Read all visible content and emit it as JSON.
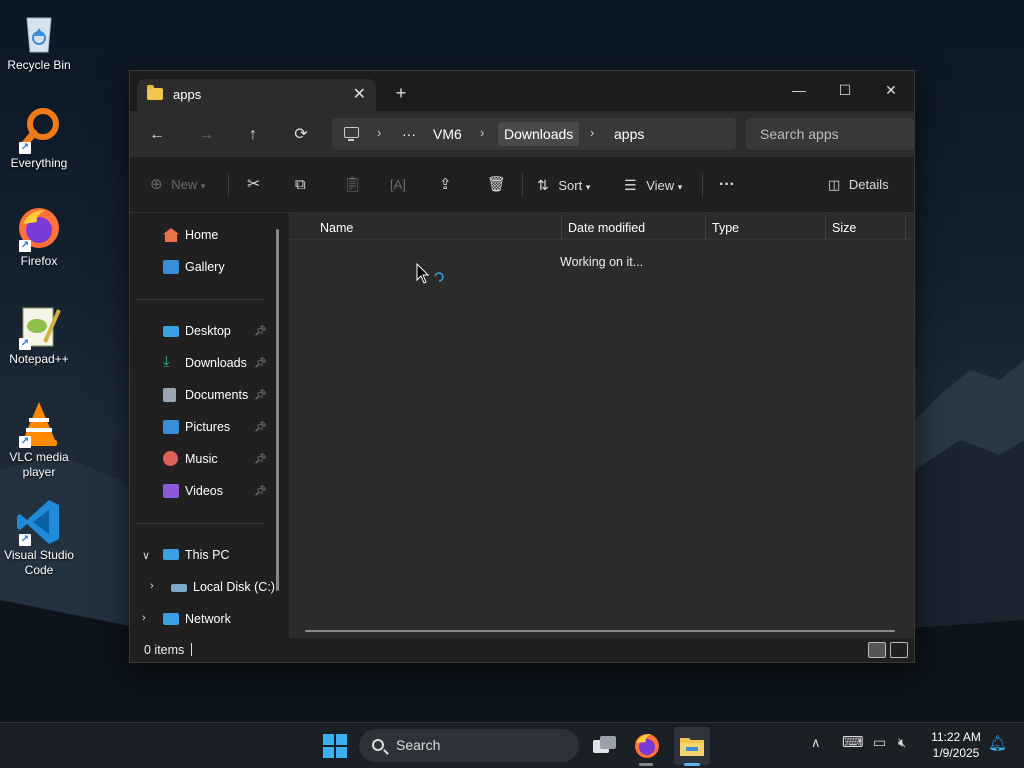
{
  "desktop": {
    "icons": [
      {
        "label": "Recycle Bin",
        "icon": "recycle-bin-icon"
      },
      {
        "label": "Everything",
        "icon": "everything-search-icon"
      },
      {
        "label": "Firefox",
        "icon": "firefox-icon"
      },
      {
        "label": "Notepad++",
        "icon": "notepadpp-icon"
      },
      {
        "label": "VLC media player",
        "icon": "vlc-icon"
      },
      {
        "label": "Visual Studio Code",
        "icon": "vscode-icon"
      }
    ]
  },
  "window": {
    "tab_title": "apps",
    "tab_close": "✕",
    "new_tab": "+",
    "controls": {
      "minimize": "—",
      "maximize": "☐",
      "close": "✕"
    }
  },
  "address": {
    "more": "···",
    "crumbs": [
      "VM6",
      "Downloads",
      "apps"
    ],
    "search_placeholder": "Search apps"
  },
  "toolbar": {
    "new_label": "New",
    "sort_label": "Sort",
    "view_label": "View",
    "more_label": "···",
    "details_label": "Details"
  },
  "sidebar": {
    "quick": [
      {
        "label": "Home",
        "color": "#e8734a"
      },
      {
        "label": "Gallery",
        "color": "#3a8fd9"
      }
    ],
    "pinned": [
      {
        "label": "Desktop",
        "color": "#3aa0e0"
      },
      {
        "label": "Downloads",
        "color": "#2fb58c"
      },
      {
        "label": "Documents",
        "color": "#9aa7b3"
      },
      {
        "label": "Pictures",
        "color": "#3a8fd9"
      },
      {
        "label": "Music",
        "color": "#e0615a"
      },
      {
        "label": "Videos",
        "color": "#8a5ad9"
      }
    ],
    "this_pc": "This PC",
    "local_disk": "Local Disk (C:)",
    "network": "Network"
  },
  "columns": {
    "name": "Name",
    "date_modified": "Date modified",
    "type": "Type",
    "size": "Size"
  },
  "content": {
    "status_message": "Working on it..."
  },
  "statusbar": {
    "items_count": "0 items"
  },
  "taskbar": {
    "search_label": "Search",
    "time": "11:22 AM",
    "date": "1/9/2025"
  }
}
